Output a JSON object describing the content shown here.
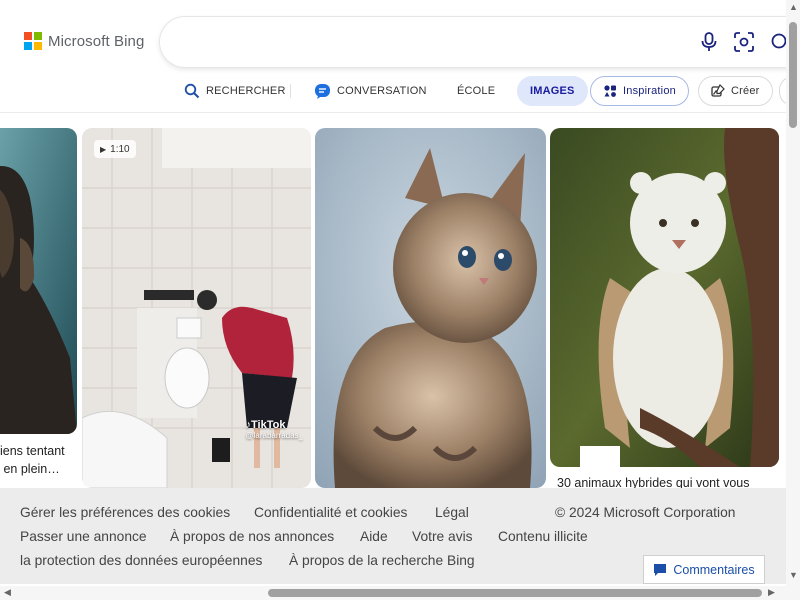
{
  "brand": {
    "logo_text": "Microsoft Bing",
    "logo_colors": [
      "#f25022",
      "#7fba00",
      "#00a4ef",
      "#ffb900"
    ]
  },
  "search": {
    "value": "",
    "placeholder": ""
  },
  "search_icons": [
    "microphone-icon",
    "visual-search-icon",
    "search-icon"
  ],
  "tabs": [
    {
      "label": "RECHERCHER",
      "icon": "search-icon"
    },
    {
      "label": "CONVERSATION",
      "icon": "copilot-chat-icon"
    },
    {
      "label": "ÉCOLE"
    },
    {
      "label": "IMAGES",
      "active": true
    },
    {
      "label": "Inspiration",
      "icon": "inspiration-icon"
    },
    {
      "label": "Créer",
      "icon": "create-image-icon"
    }
  ],
  "results": [
    {
      "caption": "iens tentant\n en plein…"
    },
    {
      "duration": "1:10",
      "watermark": "TikTok",
      "handle": "@larabarradas_"
    },
    {
      "caption": ""
    },
    {
      "caption": "30 animaux hybrides qui vont vous"
    }
  ],
  "footer": {
    "links": [
      "Gérer les préférences des cookies",
      "Confidentialité et cookies",
      "Légal",
      "Passer une annonce",
      "À propos de nos annonces",
      "Aide",
      "Votre avis",
      "Contenu illicite",
      "la protection des données européennes",
      "À propos de la recherche Bing"
    ],
    "copyright": "© 2024 Microsoft Corporation",
    "feedback_label": "Commentaires"
  },
  "colors": {
    "accent": "#1a1a9f",
    "active_tab_bg": "#dfe7fb",
    "footer_bg": "#ececec"
  }
}
